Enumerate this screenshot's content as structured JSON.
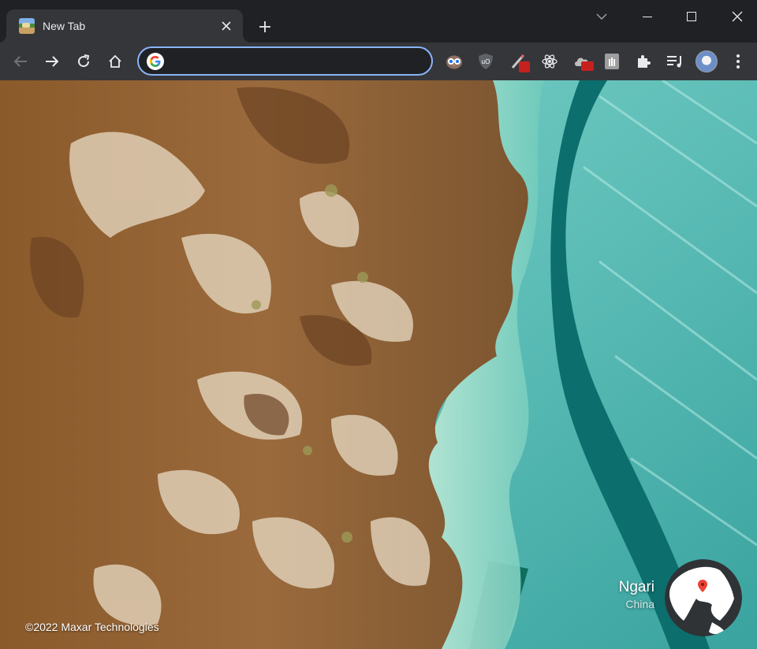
{
  "tab": {
    "title": "New Tab",
    "favicon": "earth-view-favicon",
    "close_icon": "close-icon"
  },
  "window_controls": [
    "tab-search-chevron-icon",
    "minimize-icon",
    "maximize-icon",
    "close-icon"
  ],
  "toolbar": {
    "nav": [
      "back-icon",
      "forward-icon",
      "reload-icon",
      "home-icon"
    ],
    "omnibox": {
      "value": "",
      "placeholder": "",
      "icon": "google-g-icon",
      "focus_color": "#8ab4f8"
    },
    "extensions": [
      "owl-extension-icon",
      "ublock-origin-icon",
      "pen-extension-icon",
      "react-devtools-icon",
      "cloud-extension-icon",
      "hand-extension-icon",
      "puzzle-extensions-icon",
      "reading-list-icon",
      "profile-avatar",
      "kebab-menu-icon"
    ]
  },
  "background": {
    "attribution": "©2022 Maxar Technologies",
    "location_name": "Ngari",
    "location_country": "China",
    "globe_icon": "globe-icon",
    "pin_color": "#ea4335"
  },
  "colors": {
    "tabstrip": "#202124",
    "toolbar": "#35363a",
    "accent": "#8ab4f8"
  }
}
